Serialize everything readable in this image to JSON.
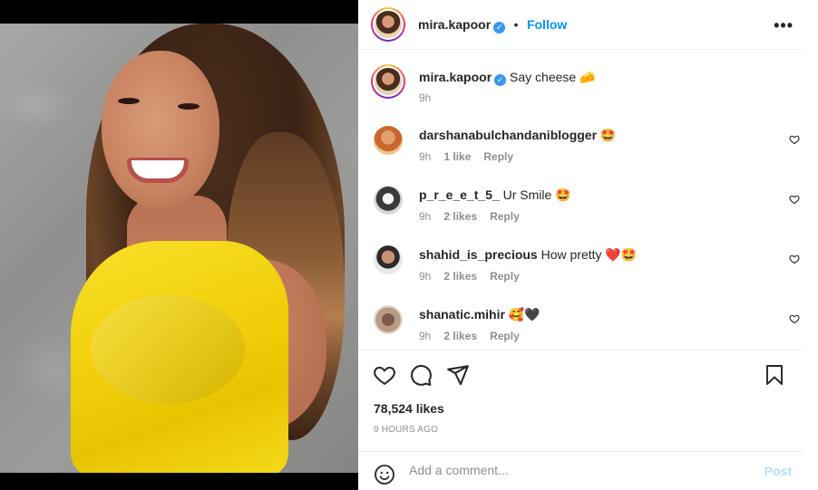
{
  "post": {
    "username": "mira.kapoor",
    "verified_mark": "✓",
    "separator": "•",
    "follow_label": "Follow",
    "more_label": "•••",
    "caption_text": "Say cheese",
    "caption_emoji": "🧀",
    "caption_time": "9h"
  },
  "comments": [
    {
      "username": "darshanabulchandaniblogger",
      "text": "🤩",
      "time": "9h",
      "likes": "1 like",
      "reply": "Reply"
    },
    {
      "username": "p_r_e_e_t_5_",
      "text": "Ur Smile 🤩",
      "time": "9h",
      "likes": "2 likes",
      "reply": "Reply"
    },
    {
      "username": "shahid_is_precious",
      "text": "How pretty ❤️🤩",
      "time": "9h",
      "likes": "2 likes",
      "reply": "Reply"
    },
    {
      "username": "shanatic.mihir",
      "text": "🥰🖤",
      "time": "9h",
      "likes": "2 likes",
      "reply": "Reply"
    }
  ],
  "stats": {
    "likes": "78,524 likes",
    "time_ago": "9 HOURS AGO"
  },
  "composer": {
    "placeholder": "Add a comment...",
    "post_label": "Post"
  },
  "icons": {
    "like": "heart-icon",
    "comment": "comment-icon",
    "share": "send-icon",
    "save": "bookmark-icon",
    "emoji": "emoji-icon"
  },
  "colors": {
    "accent": "#0095f6",
    "verified": "#3897f0",
    "post_disabled": "#b2dffc",
    "muted": "#8e8e8e"
  }
}
